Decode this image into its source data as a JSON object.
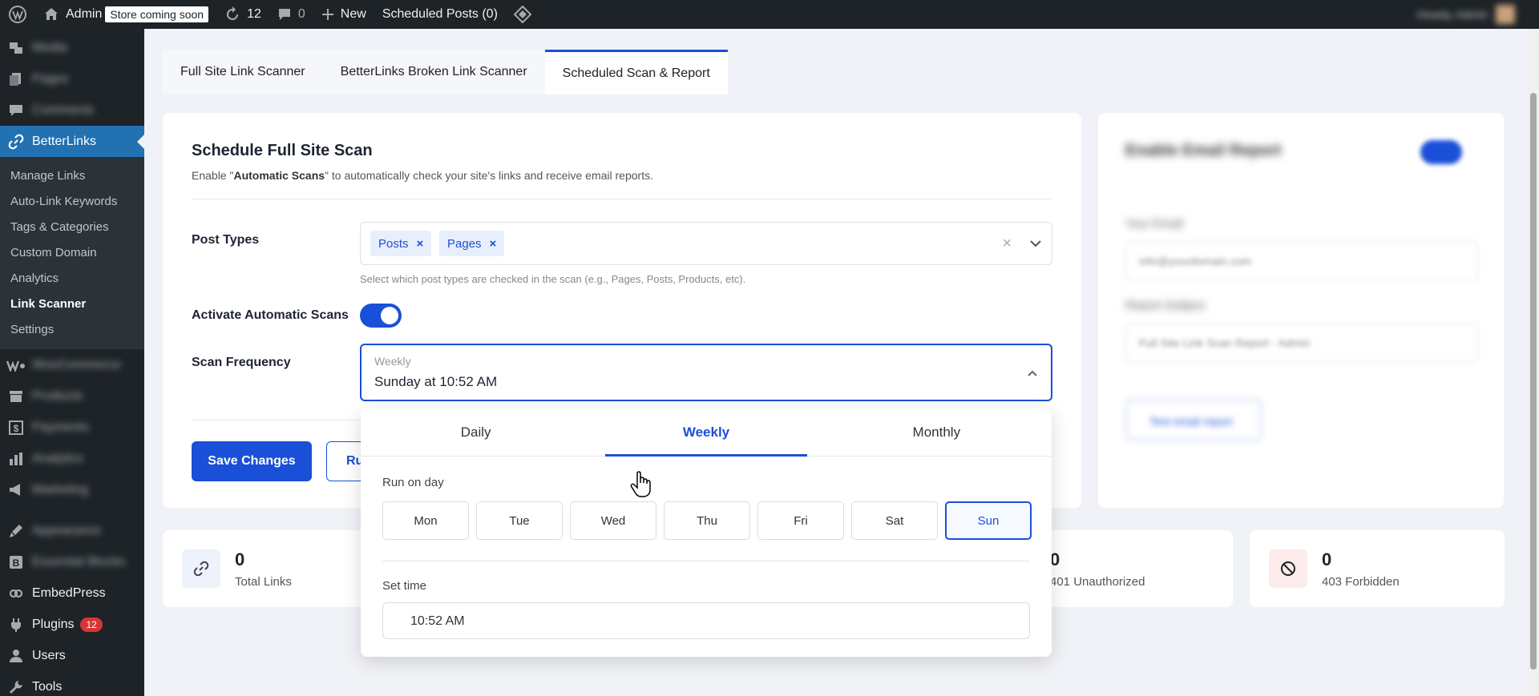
{
  "adminbar": {
    "site_name": "Admin",
    "store_badge": "Store coming soon",
    "updates_count": "12",
    "comments_count": "0",
    "new_label": "New",
    "scheduled_posts": "Scheduled Posts (0)",
    "howdy": "Howdy, Admin"
  },
  "sidebar": {
    "top_items": [
      "Media",
      "Pages",
      "Comments"
    ],
    "active": "BetterLinks",
    "submenu": [
      "Manage Links",
      "Auto-Link Keywords",
      "Tags & Categories",
      "Custom Domain",
      "Analytics",
      "Link Scanner",
      "Settings"
    ],
    "current_sub": "Link Scanner",
    "blurred_items": [
      "WooCommerce",
      "Products",
      "Payments",
      "Analytics",
      "Marketing",
      "Appearance",
      "Essential Blocks"
    ],
    "embedpress": "EmbedPress",
    "plugins": "Plugins",
    "plugins_badge": "12",
    "users": "Users",
    "tools": "Tools"
  },
  "tabs": [
    "Full Site Link Scanner",
    "BetterLinks Broken Link Scanner",
    "Scheduled Scan & Report"
  ],
  "main": {
    "title": "Schedule Full Site Scan",
    "desc_pre": "Enable \"",
    "desc_bold": "Automatic Scans",
    "desc_post": "\" to automatically check your site's links and receive email reports.",
    "post_types_label": "Post Types",
    "chips": [
      "Posts",
      "Pages"
    ],
    "post_types_hint": "Select which post types are checked in the scan (e.g., Pages, Posts, Products, etc).",
    "auto_scans_label": "Activate Automatic Scans",
    "auto_scans_on": true,
    "frequency_label": "Scan Frequency",
    "frequency_type": "Weekly",
    "frequency_value": "Sunday at 10:52 AM",
    "save_label": "Save Changes",
    "run_label": "Ru"
  },
  "right_card": {
    "title": "Enable Email Report",
    "email_label": "Your Email",
    "email_value": "info@yourdomain.com",
    "subject_label": "Report Subject",
    "subject_value": "Full Site Link Scan Report - Admin",
    "button": "Test email report"
  },
  "stats": [
    {
      "num": "0",
      "label": "Total Links"
    },
    {
      "num": "0",
      "label": "401 Unauthorized"
    },
    {
      "num": "0",
      "label": "403 Forbidden"
    }
  ],
  "popup": {
    "tabs": [
      "Daily",
      "Weekly",
      "Monthly"
    ],
    "active_tab": "Weekly",
    "run_on_day_label": "Run on day",
    "days": [
      "Mon",
      "Tue",
      "Wed",
      "Thu",
      "Fri",
      "Sat",
      "Sun"
    ],
    "selected_day": "Sun",
    "set_time_label": "Set time",
    "time_value": "10:52 AM"
  },
  "colors": {
    "accent": "#1a4fd8",
    "wp_dark": "#1d2327",
    "wp_blue": "#2271b1"
  }
}
